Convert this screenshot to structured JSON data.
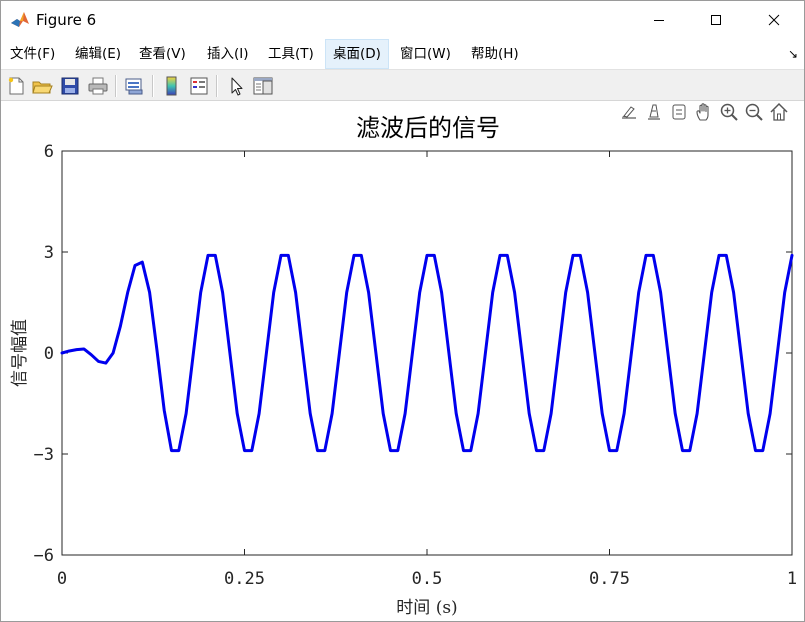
{
  "window": {
    "title": "Figure 6",
    "controls": {
      "minimize": "minimize-icon",
      "maximize": "maximize-icon",
      "close": "close-icon"
    }
  },
  "menu": {
    "items": [
      "文件(F)",
      "编辑(E)",
      "查看(V)",
      "插入(I)",
      "工具(T)",
      "桌面(D)",
      "窗口(W)",
      "帮助(H)"
    ],
    "active": "桌面(D)",
    "overflow_glyph": "↘"
  },
  "toolbar": {
    "buttons": [
      "new-figure-icon",
      "open-file-icon",
      "save-icon",
      "print-icon",
      "link-plot-icon",
      "colorbar-icon",
      "legend-icon",
      "edit-plot-icon",
      "property-inspector-icon"
    ]
  },
  "axes_toolbar": {
    "buttons": [
      "brush-icon",
      "data-tips-icon",
      "export-icon",
      "pan-icon",
      "zoom-in-icon",
      "zoom-out-icon",
      "restore-view-icon"
    ]
  },
  "colors": {
    "line": "#0000ee",
    "accent_menu": "#e5f1fb"
  },
  "chart_data": {
    "type": "line",
    "title": "滤波后的信号",
    "xlabel": "时间 (s)",
    "ylabel": "信号幅值",
    "xlim": [
      0,
      1
    ],
    "ylim": [
      -6,
      6
    ],
    "xticks": [
      0,
      0.25,
      0.5,
      0.75,
      1
    ],
    "xtick_labels": [
      "0",
      "0.25",
      "0.5",
      "0.75",
      "1"
    ],
    "yticks": [
      -6,
      -3,
      0,
      3,
      6
    ],
    "ytick_labels": [
      "−6",
      "−3",
      "0",
      "3",
      "6"
    ],
    "grid": false,
    "series": [
      {
        "color": "#0000ee",
        "x": [
          0,
          0.01,
          0.02,
          0.03,
          0.04,
          0.05,
          0.06,
          0.07,
          0.08,
          0.09,
          0.1,
          0.11,
          0.12,
          0.13,
          0.14,
          0.15,
          0.16,
          0.17,
          0.18,
          0.19,
          0.2,
          0.21,
          0.22,
          0.23,
          0.24,
          0.25,
          0.26,
          0.27,
          0.28,
          0.29,
          0.3,
          0.31,
          0.32,
          0.33,
          0.34,
          0.35,
          0.36,
          0.37,
          0.38,
          0.39,
          0.4,
          0.41,
          0.42,
          0.43,
          0.44,
          0.45,
          0.46,
          0.47,
          0.48,
          0.49,
          0.5,
          0.51,
          0.52,
          0.53,
          0.54,
          0.55,
          0.56,
          0.57,
          0.58,
          0.59,
          0.6,
          0.61,
          0.62,
          0.63,
          0.64,
          0.65,
          0.66,
          0.67,
          0.68,
          0.69,
          0.7,
          0.71,
          0.72,
          0.73,
          0.74,
          0.75,
          0.76,
          0.77,
          0.78,
          0.79,
          0.8,
          0.81,
          0.82,
          0.83,
          0.84,
          0.85,
          0.86,
          0.87,
          0.88,
          0.89,
          0.9,
          0.91,
          0.92,
          0.93,
          0.94,
          0.95,
          0.96,
          0.97,
          0.98,
          0.99,
          1.0
        ],
        "y": [
          0.0,
          0.06,
          0.1,
          0.12,
          -0.05,
          -0.25,
          -0.3,
          0.0,
          0.8,
          1.8,
          2.6,
          2.7,
          1.8,
          0.1,
          -1.7,
          -2.9,
          -2.9,
          -1.8,
          0.0,
          1.8,
          2.9,
          2.9,
          1.8,
          0.0,
          -1.8,
          -2.9,
          -2.9,
          -1.8,
          0.0,
          1.8,
          2.9,
          2.9,
          1.8,
          0.0,
          -1.8,
          -2.9,
          -2.9,
          -1.8,
          0.0,
          1.8,
          2.9,
          2.9,
          1.8,
          0.0,
          -1.8,
          -2.9,
          -2.9,
          -1.8,
          0.0,
          1.8,
          2.9,
          2.9,
          1.8,
          0.0,
          -1.8,
          -2.9,
          -2.9,
          -1.8,
          0.0,
          1.8,
          2.9,
          2.9,
          1.8,
          0.0,
          -1.8,
          -2.9,
          -2.9,
          -1.8,
          0.0,
          1.8,
          2.9,
          2.9,
          1.8,
          0.0,
          -1.8,
          -2.9,
          -2.9,
          -1.8,
          0.0,
          1.8,
          2.9,
          2.9,
          1.8,
          0.0,
          -1.8,
          -2.9,
          -2.9,
          -1.8,
          0.0,
          1.8,
          2.9,
          2.9,
          1.8,
          0.0,
          -1.8,
          -2.9,
          -2.9,
          -1.8,
          0.0,
          1.8,
          2.9
        ]
      }
    ]
  }
}
